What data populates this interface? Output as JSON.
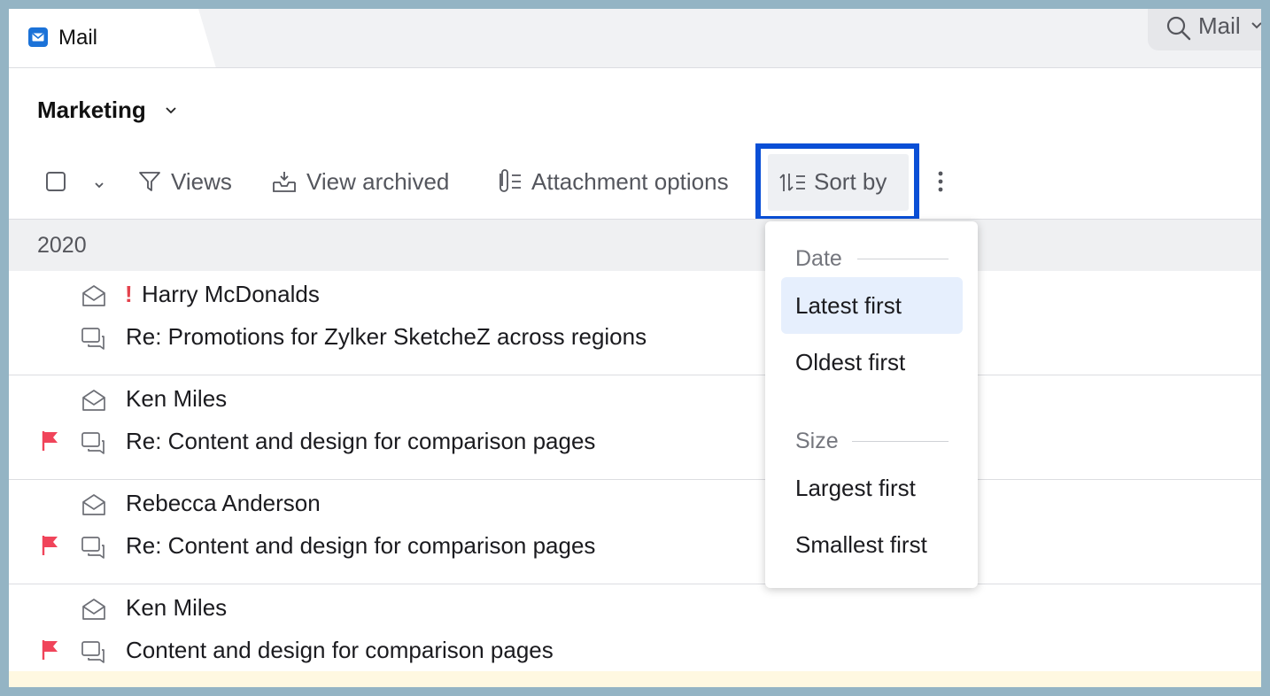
{
  "tab": {
    "label": "Mail",
    "icon": "mail-app-icon"
  },
  "search": {
    "label": "Mail",
    "icon": "search-icon"
  },
  "folder": {
    "title": "Marketing"
  },
  "toolbar": {
    "views_label": "Views",
    "view_archived_label": "View archived",
    "attachment_options_label": "Attachment options",
    "sort_by_label": "Sort by"
  },
  "list": {
    "group_header": "2020",
    "rows": [
      {
        "sender": "Harry McDonalds",
        "subject": "Re: Promotions for Zylker SketcheZ across regions",
        "important_mark": "!",
        "flagged": false
      },
      {
        "sender": "Ken Miles",
        "subject": "Re: Content and design for comparison pages",
        "flagged": true
      },
      {
        "sender": "Rebecca Anderson",
        "subject": "Re: Content and design for comparison pages",
        "flagged": true
      },
      {
        "sender": "Ken Miles",
        "subject": "Content and design for comparison pages",
        "flagged": true
      }
    ]
  },
  "sort_menu": {
    "date_header": "Date",
    "latest_first": "Latest first",
    "oldest_first": "Oldest first",
    "size_header": "Size",
    "largest_first": "Largest first",
    "smallest_first": "Smallest first",
    "selected": "Latest first"
  },
  "colors": {
    "accent_highlight": "#0a4fd6",
    "flag": "#f0445a",
    "selected_option_bg": "#e6effd",
    "app_icon": "#1b72d8"
  }
}
